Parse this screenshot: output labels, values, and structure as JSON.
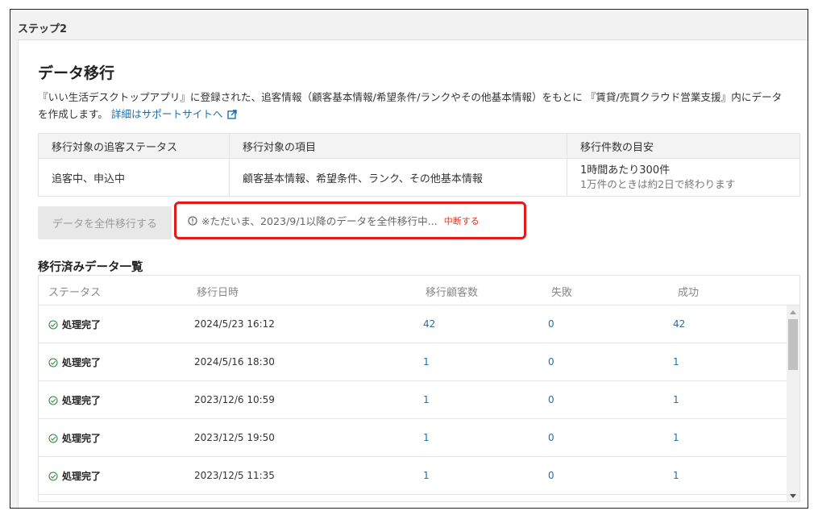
{
  "step": {
    "label": "ステップ2"
  },
  "section": {
    "title": "データ移行",
    "description": "『いい生活デスクトップアプリ』に登録された、追客情報（顧客基本情報/希望条件/ランクやその他基本情報）をもとに 『賃貸/売買クラウド営業支援』内にデータを作成します。",
    "support_link": "詳細はサポートサイトへ",
    "support_icon": "external-link-icon"
  },
  "info_table": {
    "headers": [
      "移行対象の追客ステータス",
      "移行対象の項目",
      "移行件数の目安"
    ],
    "row": {
      "status": "追客中、申込中",
      "items": "顧客基本情報、希望条件、ランク、その他基本情報",
      "estimate_main": "1時間あたり300件",
      "estimate_sub": "1万件のときは約2日で終わります"
    }
  },
  "migrate_button": {
    "label": "データを全件移行する"
  },
  "migration_status": {
    "icon": "info-icon",
    "message": "※ただいま、2023/9/1以降のデータを全件移行中...",
    "stop_label": "中断する",
    "highlight_color": "#e11a1a"
  },
  "list": {
    "title": "移行済みデータ一覧",
    "headers": {
      "status": "ステータス",
      "date": "移行日時",
      "customers": "移行顧客数",
      "failed": "失敗",
      "success": "成功"
    },
    "rows": [
      {
        "status": "処理完了",
        "date": "2024/5/23 16:12",
        "customers": "42",
        "failed": "0",
        "success": "42"
      },
      {
        "status": "処理完了",
        "date": "2024/5/16 18:30",
        "customers": "1",
        "failed": "0",
        "success": "1"
      },
      {
        "status": "処理完了",
        "date": "2023/12/6 10:59",
        "customers": "1",
        "failed": "0",
        "success": "1"
      },
      {
        "status": "処理完了",
        "date": "2023/12/5 19:50",
        "customers": "1",
        "failed": "0",
        "success": "1"
      },
      {
        "status": "処理完了",
        "date": "2023/12/5 11:35",
        "customers": "1",
        "failed": "0",
        "success": "1"
      }
    ]
  },
  "colors": {
    "link": "#1a6fb5",
    "success": "#2e8b3e",
    "danger": "#e0341e"
  }
}
